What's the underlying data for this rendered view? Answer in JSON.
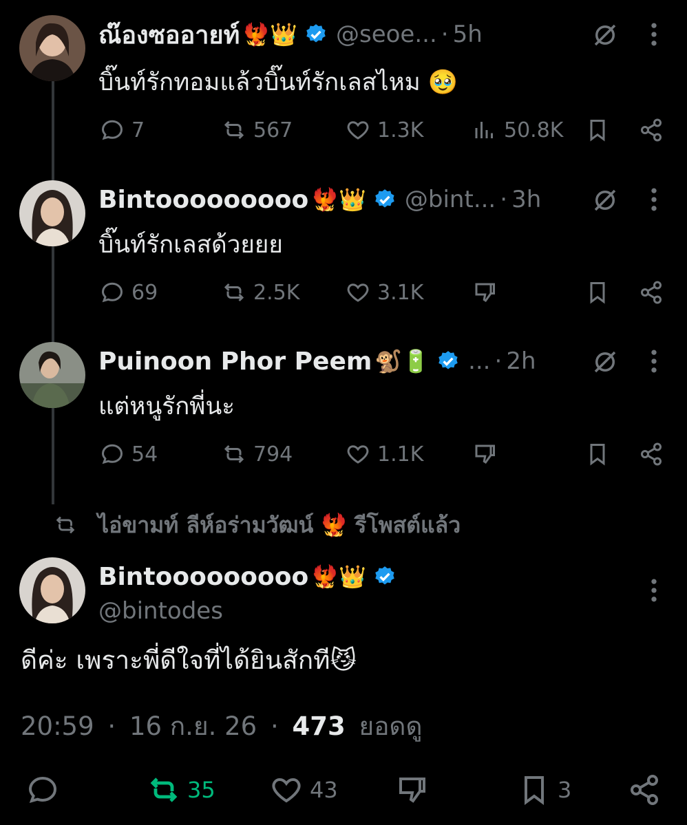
{
  "tweets": [
    {
      "name": "ณ๊องซออายท์",
      "emoji": "🐦‍🔥👑",
      "handle": "@seoe...",
      "time": "5h",
      "text": "บิ๊นท์รักทอมแล้วบิ๊นท์รักเลสไหม 🥹",
      "replies": "7",
      "reposts": "567",
      "likes": "1.3K",
      "views": "50.8K"
    },
    {
      "name": "Bintooooooooo",
      "emoji": "🐦‍🔥👑",
      "handle": "@bint...",
      "time": "3h",
      "text": "บิ๊นท์รักเลสด้วยยย",
      "replies": "69",
      "reposts": "2.5K",
      "likes": "3.1K"
    },
    {
      "name": "Puinoon Phor Peem",
      "emoji": "🐒🔋",
      "handle": "...",
      "time": "2h",
      "text": "แต่หนูรักพี่นะ",
      "replies": "54",
      "reposts": "794",
      "likes": "1.1K"
    }
  ],
  "repost_notice": {
    "text": "ไอ่ขามท์ ลีห์อร่ามวัฒน์",
    "emoji": "🐦‍🔥",
    "suffix": "รีโพสต์แล้ว"
  },
  "main": {
    "name": "Bintooooooooo",
    "emoji": "🐦‍🔥👑",
    "handle": "@bintodes",
    "text": "ดีค่ะ เพราะพี่ดีใจที่ได้ยินสักที😼",
    "time": "20:59",
    "date": "16 ก.ย. 26",
    "views_count": "473",
    "views_label": "ยอดดู",
    "reposts": "35",
    "likes": "43",
    "bookmarks": "3"
  },
  "separator": "·",
  "colors": {
    "background": "#000000",
    "muted": "#71767b",
    "verified": "#1d9bf0",
    "repost_active": "#00ba7c",
    "text": "#e7e9ea"
  }
}
